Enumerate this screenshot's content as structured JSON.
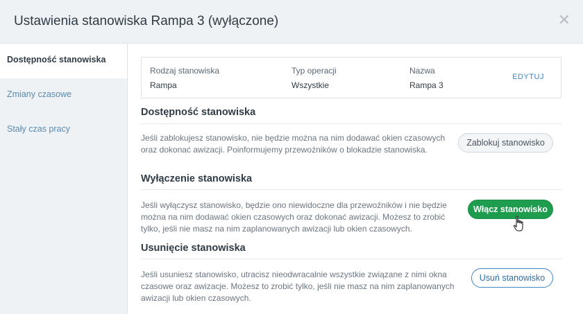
{
  "modal": {
    "title": "Ustawienia stanowiska Rampa 3 (wyłączone)",
    "close_icon": "close-icon"
  },
  "sidebar": {
    "items": [
      {
        "label": "Dostępność stanowiska",
        "active": true
      },
      {
        "label": "Zmiany czasowe",
        "active": false
      },
      {
        "label": "Stały czas pracy",
        "active": false
      }
    ]
  },
  "info": {
    "type_label": "Rodzaj stanowiska",
    "type_value": "Rampa",
    "operation_label": "Typ operacji",
    "operation_value": "Wszystkie",
    "name_label": "Nazwa",
    "name_value": "Rampa 3",
    "edit_label": "EDYTUJ"
  },
  "availability": {
    "title": "Dostępność stanowiska",
    "line1": "Jeśli zablokujesz stanowisko, nie będzie można na nim dodawać okien czasowych",
    "line2": "oraz dokonać awizacji. Poinformujemy przewoźników o blokadzie stanowiska.",
    "button": "Zablokuj stanowisko"
  },
  "disable": {
    "title": "Wyłączenie stanowiska",
    "line1": "Jeśli wyłączysz stanowisko, będzie ono niewidoczne dla przewoźników i nie będzie",
    "line2": "można na nim dodawać okien czasowych oraz dokonać awizacji. Możesz to zrobić",
    "line3": "tylko, jeśli nie masz na nim zaplanowanych awizacji lub okien czasowych.",
    "button": "Włącz stanowisko"
  },
  "delete": {
    "title": "Usunięcie stanowiska",
    "line1": "Jeśli usuniesz stanowisko, utracisz nieodwracalnie wszystkie związane z nimi okna",
    "line2": "czasowe oraz awizacje. Możesz to zrobić tylko, jeśli nie masz na nim zaplanowanych",
    "line3": "awizacji lub okien czasowych.",
    "button": "Usuń stanowisko"
  },
  "colors": {
    "accent_green": "#1f9d4e",
    "link_blue": "#3c84c8",
    "panel_bg": "#eef2f5"
  },
  "cursor_icon": "hand-pointer-icon"
}
